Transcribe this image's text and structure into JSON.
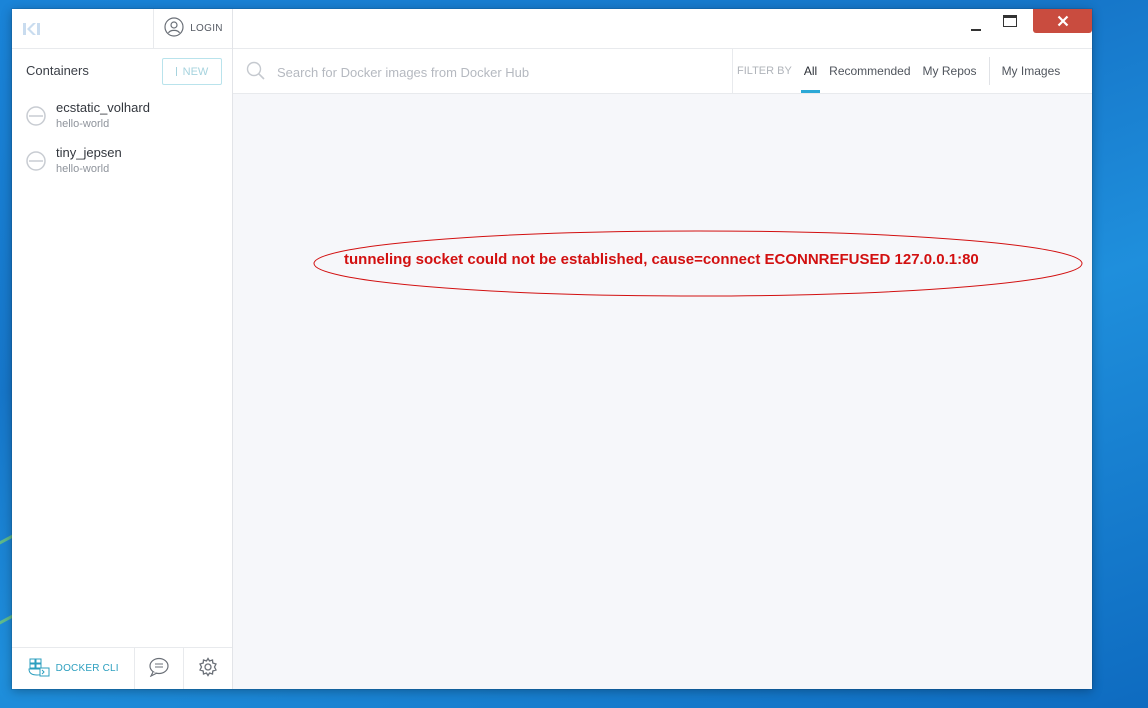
{
  "app": {
    "logo_icon": "kitematic-logo-icon",
    "window_controls": [
      "minimize-icon",
      "maximize-icon",
      "close-icon"
    ],
    "close_color": "#c94c3f"
  },
  "sidebar": {
    "login_label": "LOGIN",
    "login_icon": "user-icon",
    "containers_title": "Containers",
    "new_button_label": "NEW",
    "containers": [
      {
        "name": "ecstatic_volhard",
        "image": "hello-world",
        "status_icon": "stopped-icon"
      },
      {
        "name": "tiny_jepsen",
        "image": "hello-world",
        "status_icon": "stopped-icon"
      }
    ],
    "footer": {
      "docker_cli_label": "DOCKER CLI",
      "docker_cli_icon": "docker-cli-icon",
      "chat_icon": "chat-icon",
      "settings_icon": "gear-icon"
    }
  },
  "search": {
    "placeholder": "Search for Docker images from Docker Hub",
    "icon": "search-icon"
  },
  "filters": {
    "label": "FILTER BY",
    "tabs": [
      "All",
      "Recommended",
      "My Repos",
      "My Images"
    ],
    "active": "All",
    "accent": "#2ba8d6"
  },
  "main": {
    "error_message": "tunneling socket could not be established, cause=connect ECONNREFUSED 127.0.0.1:80",
    "error_color": "#d21010"
  }
}
